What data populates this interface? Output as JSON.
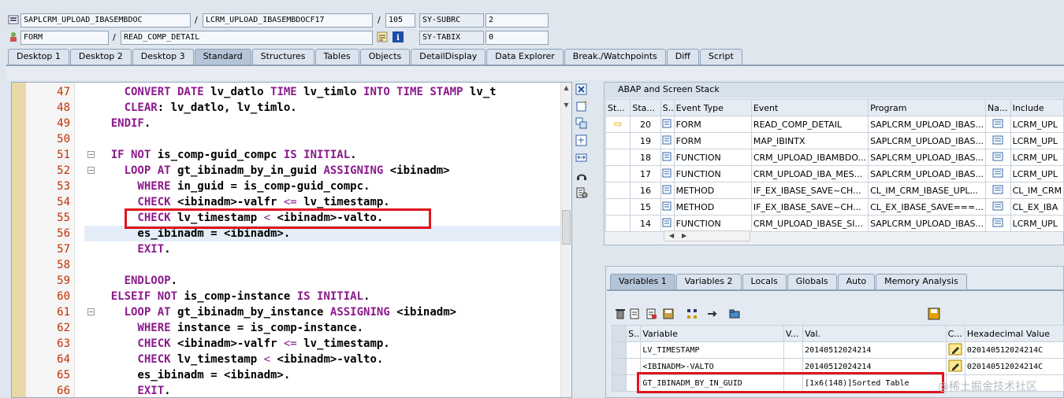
{
  "header": {
    "row1": {
      "program": "SAPLCRM_UPLOAD_IBASEMBDOC",
      "include": "LCRM_UPLOAD_IBASEMBDOCF17",
      "line": "105",
      "sy_label": "SY-SUBRC",
      "sy_value": "2"
    },
    "row2": {
      "event_type": "FORM",
      "event": "READ_COMP_DETAIL",
      "sy_label": "SY-TABIX",
      "sy_value": "0"
    },
    "sep": "/"
  },
  "tabs": [
    "Desktop 1",
    "Desktop 2",
    "Desktop 3",
    "Standard",
    "Structures",
    "Tables",
    "Objects",
    "DetailDisplay",
    "Data Explorer",
    "Break./Watchpoints",
    "Diff",
    "Script"
  ],
  "active_tab": "Standard",
  "code": {
    "lines": [
      {
        "num": "47",
        "parts": [
          [
            "kw",
            "      CONVERT DATE "
          ],
          [
            "tx",
            "lv_datlo "
          ],
          [
            "kw",
            "TIME "
          ],
          [
            "tx",
            "lv_timlo "
          ],
          [
            "kw",
            "INTO TIME STAMP "
          ],
          [
            "tx",
            "lv_t"
          ]
        ]
      },
      {
        "num": "48",
        "parts": [
          [
            "kw",
            "      CLEAR"
          ],
          [
            "tx",
            ": lv_datlo, lv_timlo."
          ]
        ]
      },
      {
        "num": "49",
        "parts": [
          [
            "kw",
            "    ENDIF"
          ],
          [
            "tx",
            "."
          ]
        ]
      },
      {
        "num": "50",
        "parts": []
      },
      {
        "num": "51",
        "parts": [
          [
            "kw",
            "    IF NOT "
          ],
          [
            "tx",
            "is_comp-guid_compc "
          ],
          [
            "kw",
            "IS INITIAL"
          ],
          [
            "tx",
            "."
          ]
        ]
      },
      {
        "num": "52",
        "parts": [
          [
            "kw",
            "      LOOP AT "
          ],
          [
            "tx",
            "gt_ibinadm_by_in_guid "
          ],
          [
            "kw",
            "ASSIGNING "
          ],
          [
            "tx",
            "<ibinadm>"
          ]
        ]
      },
      {
        "num": "53",
        "parts": [
          [
            "kw",
            "        WHERE "
          ],
          [
            "tx",
            "in_guid = is_comp-guid_compc."
          ]
        ]
      },
      {
        "num": "54",
        "parts": [
          [
            "kw",
            "        CHECK "
          ],
          [
            "tx",
            "<ibinadm>-valfr "
          ],
          [
            "op",
            "<="
          ],
          [
            "tx",
            " lv_timestamp."
          ]
        ]
      },
      {
        "num": "55",
        "parts": [
          [
            "kw",
            "        CHECK "
          ],
          [
            "tx",
            "lv_timestamp "
          ],
          [
            "op",
            "<"
          ],
          [
            "tx",
            " <ibinadm>-valto."
          ]
        ]
      },
      {
        "num": "56",
        "parts": [
          [
            "tx",
            "        es_ibinadm = <ibinadm>."
          ]
        ]
      },
      {
        "num": "57",
        "parts": [
          [
            "kw",
            "        EXIT"
          ],
          [
            "tx",
            "."
          ]
        ]
      },
      {
        "num": "58",
        "parts": []
      },
      {
        "num": "59",
        "parts": [
          [
            "kw",
            "      ENDLOOP"
          ],
          [
            "tx",
            "."
          ]
        ]
      },
      {
        "num": "60",
        "parts": [
          [
            "kw",
            "    ELSEIF NOT "
          ],
          [
            "tx",
            "is_comp-instance "
          ],
          [
            "kw",
            "IS INITIAL"
          ],
          [
            "tx",
            "."
          ]
        ]
      },
      {
        "num": "61",
        "parts": [
          [
            "kw",
            "      LOOP AT "
          ],
          [
            "tx",
            "gt_ibinadm_by_instance "
          ],
          [
            "kw",
            "ASSIGNING "
          ],
          [
            "tx",
            "<ibinadm>"
          ]
        ]
      },
      {
        "num": "62",
        "parts": [
          [
            "kw",
            "        WHERE "
          ],
          [
            "tx",
            "instance = is_comp-instance."
          ]
        ]
      },
      {
        "num": "63",
        "parts": [
          [
            "kw",
            "        CHECK "
          ],
          [
            "tx",
            "<ibinadm>-valfr "
          ],
          [
            "op",
            "<="
          ],
          [
            "tx",
            " lv_timestamp."
          ]
        ]
      },
      {
        "num": "64",
        "parts": [
          [
            "kw",
            "        CHECK "
          ],
          [
            "tx",
            "lv_timestamp "
          ],
          [
            "op",
            "<"
          ],
          [
            "tx",
            " <ibinadm>-valto."
          ]
        ]
      },
      {
        "num": "65",
        "parts": [
          [
            "tx",
            "        es_ibinadm = <ibinadm>."
          ]
        ]
      },
      {
        "num": "66",
        "parts": [
          [
            "kw",
            "        EXIT"
          ],
          [
            "tx",
            "."
          ]
        ]
      }
    ]
  },
  "stack": {
    "title": "ABAP and Screen Stack",
    "columns": [
      "St...",
      "Sta...",
      "S...",
      "Event Type",
      "Event",
      "Program",
      "Na...",
      "Include"
    ],
    "rows": [
      {
        "level": "20",
        "type": "FORM",
        "event": "READ_COMP_DETAIL",
        "program": "SAPLCRM_UPLOAD_IBAS...",
        "include": "LCRM_UPL",
        "current": true
      },
      {
        "level": "19",
        "type": "FORM",
        "event": "MAP_IBINTX",
        "program": "SAPLCRM_UPLOAD_IBAS...",
        "include": "LCRM_UPL"
      },
      {
        "level": "18",
        "type": "FUNCTION",
        "event": "CRM_UPLOAD_IBAMBDO...",
        "program": "SAPLCRM_UPLOAD_IBAS...",
        "include": "LCRM_UPL"
      },
      {
        "level": "17",
        "type": "FUNCTION",
        "event": "CRM_UPLOAD_IBA_MES...",
        "program": "SAPLCRM_UPLOAD_IBAS...",
        "include": "LCRM_UPL"
      },
      {
        "level": "16",
        "type": "METHOD",
        "event": "IF_EX_IBASE_SAVE~CH...",
        "program": "CL_IM_CRM_IBASE_UPL...",
        "include": "CL_IM_CRM"
      },
      {
        "level": "15",
        "type": "METHOD",
        "event": "IF_EX_IBASE_SAVE~CH...",
        "program": "CL_EX_IBASE_SAVE===...",
        "include": "CL_EX_IBA"
      },
      {
        "level": "14",
        "type": "FUNCTION",
        "event": "CRM_UPLOAD_IBASE_SI...",
        "program": "SAPLCRM_UPLOAD_IBAS...",
        "include": "LCRM_UPL"
      }
    ]
  },
  "var_tabs": [
    "Variables 1",
    "Variables 2",
    "Locals",
    "Globals",
    "Auto",
    "Memory Analysis"
  ],
  "vars": {
    "columns": [
      "S...",
      "Variable",
      "V...",
      "Val.",
      "C...",
      "Hexadecimal Value"
    ],
    "rows": [
      {
        "name": "LV_TIMESTAMP",
        "value": "20140512024214",
        "hex": "020140512024214C"
      },
      {
        "name": "<IBINADM>-VALTO",
        "value": "20140512024214",
        "hex": "020140512024214C"
      },
      {
        "name": "GT_IBINADM_BY_IN_GUID",
        "value": "[1x6(148)]Sorted Table",
        "hex": ""
      }
    ]
  },
  "watermark": "@稀土掘金技术社区"
}
